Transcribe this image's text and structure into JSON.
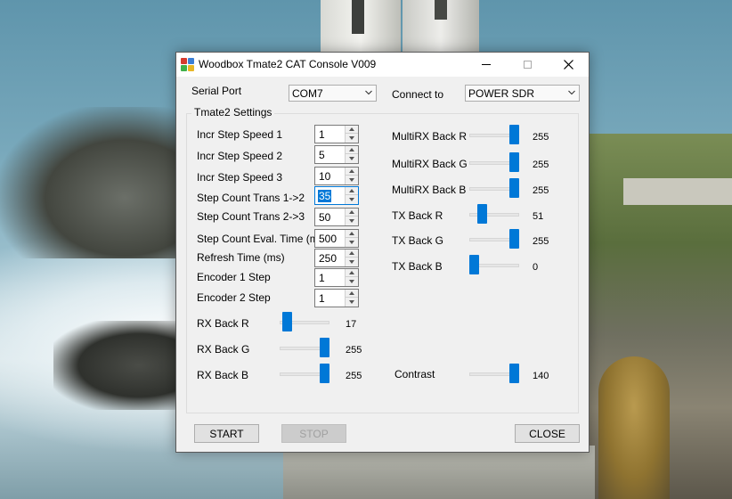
{
  "window": {
    "title": "Woodbox Tmate2 CAT Console V009",
    "minimize_glyph": "—",
    "close_glyph": "✕"
  },
  "serial_port": {
    "label": "Serial Port",
    "value": "COM7"
  },
  "connect_to": {
    "label": "Connect to",
    "value": "POWER SDR"
  },
  "group": {
    "title": "Tmate2 Settings"
  },
  "spinners": [
    {
      "label": "Incr Step Speed 1",
      "value": "1"
    },
    {
      "label": "Incr Step Speed 2",
      "value": "5"
    },
    {
      "label": "Incr Step Speed 3",
      "value": "10"
    },
    {
      "label": "Step Count Trans 1->2",
      "value": "35",
      "selected": true
    },
    {
      "label": "Step Count Trans 2->3",
      "value": "50"
    },
    {
      "label": "Step Count Eval. Time (ms)",
      "value": "500"
    },
    {
      "label": "Refresh Time (ms)",
      "value": "250"
    },
    {
      "label": "Encoder  1 Step",
      "value": "1"
    },
    {
      "label": "Encoder  2 Step",
      "value": "1"
    }
  ],
  "left_sliders": [
    {
      "label": "RX Back R",
      "value": "17",
      "level": 17,
      "max": 255
    },
    {
      "label": "RX Back G",
      "value": "255",
      "level": 255,
      "max": 255
    },
    {
      "label": "RX Back B",
      "value": "255",
      "level": 255,
      "max": 255
    }
  ],
  "right_sliders": [
    {
      "label": "MultiRX Back R",
      "value": "255",
      "level": 255,
      "max": 255
    },
    {
      "label": "MultiRX Back G",
      "value": "255",
      "level": 255,
      "max": 255
    },
    {
      "label": "MultiRX Back B",
      "value": "255",
      "level": 255,
      "max": 255
    },
    {
      "label": "TX Back R",
      "value": "51",
      "level": 51,
      "max": 255
    },
    {
      "label": "TX Back G",
      "value": "255",
      "level": 255,
      "max": 255
    },
    {
      "label": "TX Back B",
      "value": "0",
      "level": 0,
      "max": 255
    }
  ],
  "contrast": {
    "label": "Contrast",
    "value": "140",
    "level": 255,
    "max": 255
  },
  "buttons": {
    "start": "START",
    "stop": "STOP",
    "close": "CLOSE"
  },
  "colors": {
    "accent": "#0078d7",
    "window_bg": "#f0f0f0"
  }
}
